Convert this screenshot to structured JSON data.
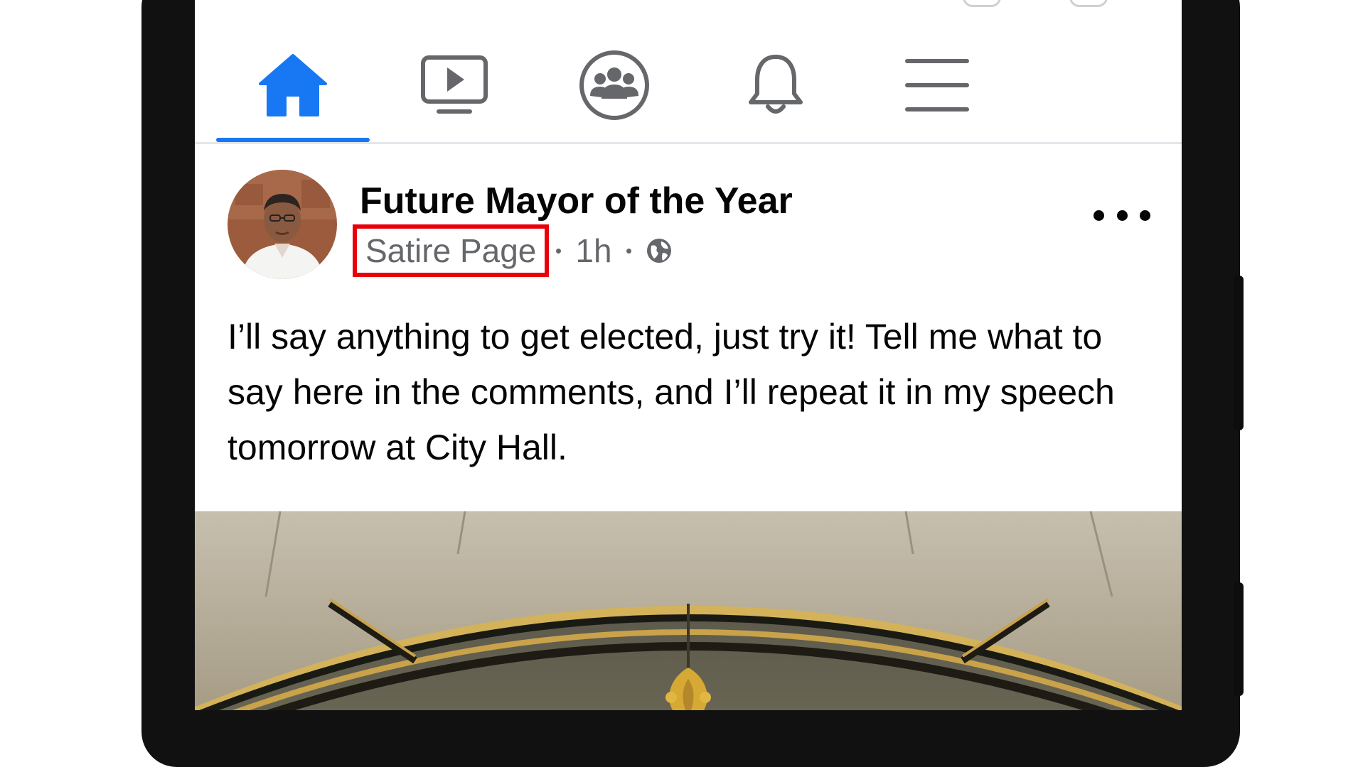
{
  "nav": {
    "tabs": [
      {
        "name": "home",
        "icon": "home-icon",
        "active": true
      },
      {
        "name": "watch",
        "icon": "video-icon",
        "active": false
      },
      {
        "name": "groups",
        "icon": "groups-icon",
        "active": false
      },
      {
        "name": "notifications",
        "icon": "bell-icon",
        "active": false
      },
      {
        "name": "menu",
        "icon": "hamburger-icon",
        "active": false
      }
    ],
    "active_color": "#1877f2",
    "inactive_color": "#65676b"
  },
  "post": {
    "author": "Future Mayor of the Year",
    "page_type": "Satire Page",
    "time": "1h",
    "audience_icon": "globe-icon",
    "body": "I’ll say anything to get elected, just try it! Tell me what to say here in the comments, and I’ll repeat it in my speech tomorrow at City Hall.",
    "highlight_color": "#e8000b"
  }
}
